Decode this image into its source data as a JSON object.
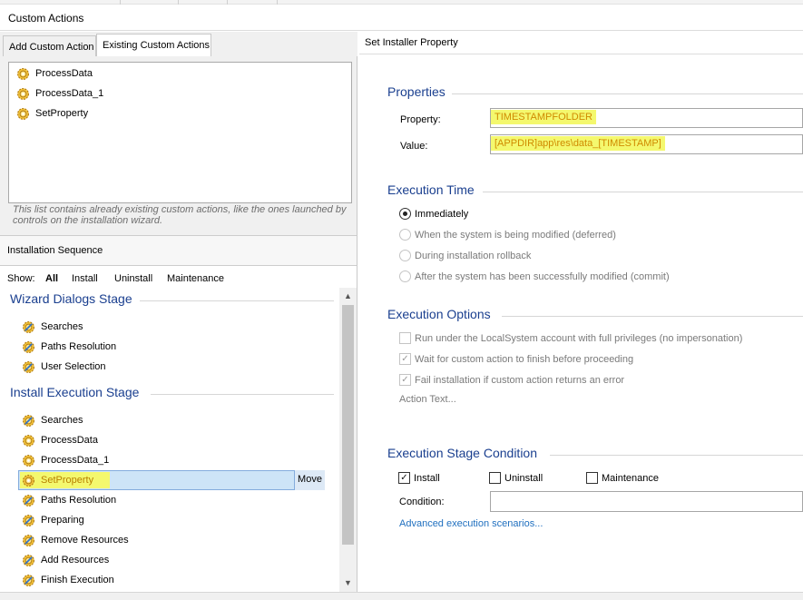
{
  "window": {
    "title": "Custom Actions"
  },
  "tabs": [
    {
      "label": "Add Custom Action"
    },
    {
      "label": "Existing Custom Actions"
    }
  ],
  "existing_actions": {
    "items": [
      "ProcessData",
      "ProcessData_1",
      "SetProperty"
    ],
    "note": "This list contains already existing custom actions, like the ones launched by controls on the installation wizard."
  },
  "sequence": {
    "header": "Installation Sequence",
    "show_label": "Show:",
    "filters": [
      "All",
      "Install",
      "Uninstall",
      "Maintenance"
    ],
    "stages": [
      {
        "title": "Wizard Dialogs Stage",
        "items": [
          "Searches",
          "Paths Resolution",
          "User Selection"
        ]
      },
      {
        "title": "Install Execution Stage",
        "items": [
          "Searches",
          "ProcessData",
          "ProcessData_1",
          "SetProperty",
          "Paths Resolution",
          "Preparing",
          "Remove Resources",
          "Add Resources",
          "Finish Execution"
        ]
      }
    ],
    "move_label": "Move"
  },
  "right": {
    "header": "Set Installer Property",
    "properties_title": "Properties",
    "property_label": "Property:",
    "property_value": "TIMESTAMPFOLDER",
    "value_label": "Value:",
    "value_value": "[APPDIR]app\\res\\data_[TIMESTAMP]",
    "exec_time_title": "Execution Time",
    "exec_time_options": [
      "Immediately",
      "When the system is being modified (deferred)",
      "During installation rollback",
      "After the system has been successfully modified (commit)"
    ],
    "exec_time_selected": 0,
    "exec_options_title": "Execution Options",
    "exec_options": [
      "Run under the LocalSystem account with full privileges (no impersonation)",
      "Wait for custom action to finish before proceeding",
      "Fail installation if custom action returns an error"
    ],
    "exec_options_checked": [
      false,
      true,
      true
    ],
    "action_text": "Action Text...",
    "stage_condition_title": "Execution Stage Condition",
    "stage_checks": [
      "Install",
      "Uninstall",
      "Maintenance"
    ],
    "stage_checks_checked": [
      true,
      false,
      false
    ],
    "condition_label": "Condition:",
    "advanced_link": "Advanced execution scenarios..."
  },
  "colors": {
    "accent": "#1a3f8f",
    "highlight": "#f4f86e",
    "link": "#1f6fbf",
    "selection": "#cde4f7"
  },
  "icons": {
    "custom_action": "gear-icon",
    "sequence_item": "gear-icon"
  }
}
